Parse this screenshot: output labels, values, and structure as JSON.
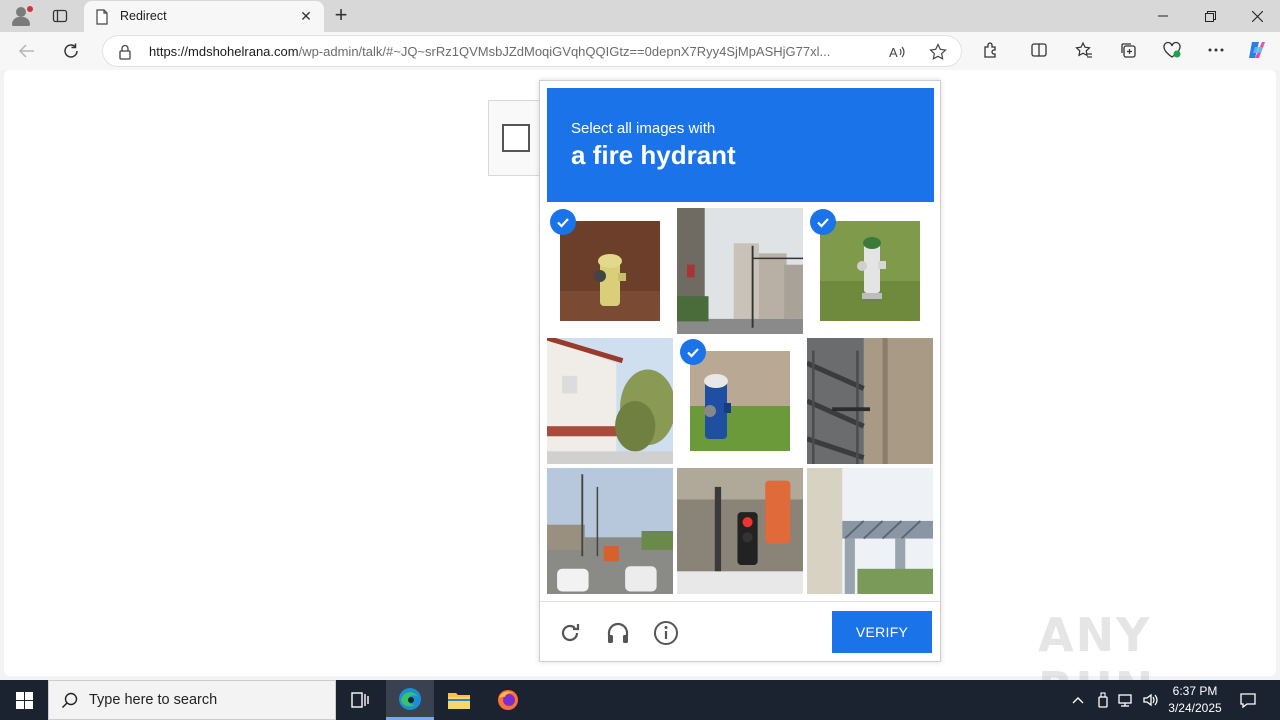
{
  "browser": {
    "tab_title": "Redirect",
    "url_host": "https://mdshohelrana.com",
    "url_path": "/wp-admin/talk/#~JQ~srRz1QVMsbJZdMoqiGVqhQQIGtz==0depnX7Ryy4SjMpASHjG77xl..."
  },
  "captcha": {
    "prompt_line1": "Select all images with",
    "prompt_line2": "a fire hydrant",
    "verify_label": "VERIFY",
    "tiles": [
      {
        "name": "yellow-hydrant",
        "selected": true
      },
      {
        "name": "street-buildings",
        "selected": false
      },
      {
        "name": "white-hydrant",
        "selected": true
      },
      {
        "name": "house-trees",
        "selected": false
      },
      {
        "name": "blue-hydrant",
        "selected": true
      },
      {
        "name": "fire-escape",
        "selected": false
      },
      {
        "name": "busy-street",
        "selected": false
      },
      {
        "name": "traffic-light",
        "selected": false
      },
      {
        "name": "bridge-structure",
        "selected": false
      }
    ]
  },
  "watermark": "ANY RUN",
  "taskbar": {
    "search_placeholder": "Type here to search",
    "time": "6:37 PM",
    "date": "3/24/2025"
  },
  "colors": {
    "accent": "#1a73e8",
    "taskbar": "#1c2330"
  }
}
